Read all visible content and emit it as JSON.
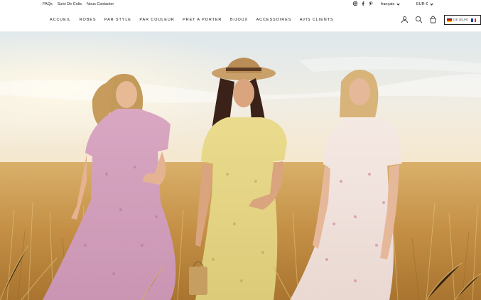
{
  "topbar": {
    "links": [
      "FAQs",
      "Suivi De Colis",
      "Nous Contacter"
    ],
    "social_icons": [
      "instagram-icon",
      "facebook-icon",
      "pinterest-icon"
    ],
    "language": "français",
    "currency": "EUR €"
  },
  "nav": {
    "menu": [
      "ACCUEIL",
      "ROBES",
      "PAR STYLE",
      "PAR COULEUR",
      "PRET A PORTER",
      "BIJOUX",
      "ACCESSOIRES",
      "AVIS CLIENTS"
    ],
    "icons": [
      "account-icon",
      "search-icon",
      "cart-icon"
    ],
    "country_selector": "DE (EUR)"
  },
  "hero": {
    "image": "three-women-in-floral-dresses-in-wheat-field"
  },
  "colors": {
    "text": "#1a1a1a",
    "sky": "#e8eef0",
    "wheat": "#c79a52",
    "dress_pink": "#d9a9c0",
    "dress_yellow": "#e8d98a",
    "dress_white": "#f1e2dc"
  }
}
